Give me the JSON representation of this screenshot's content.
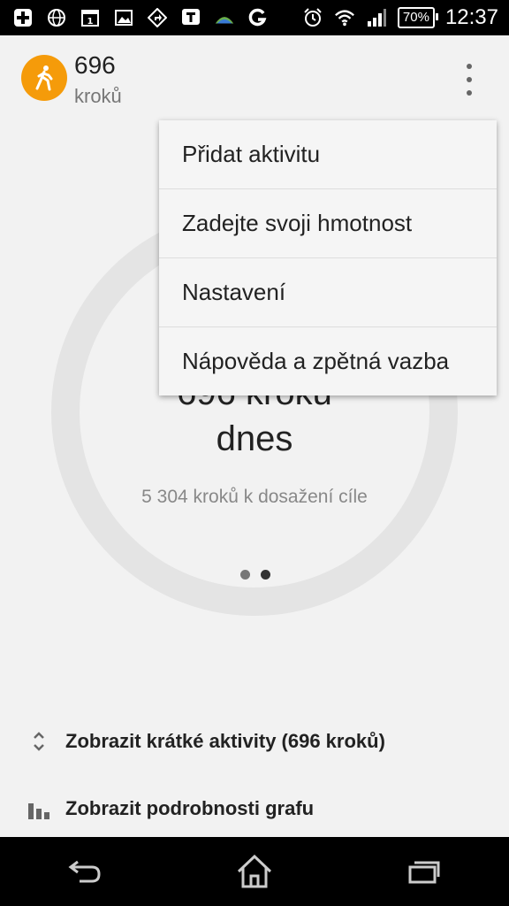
{
  "status_bar": {
    "battery": "70%",
    "time": "12:37",
    "icons": [
      "plus-badge-icon",
      "globe-icon",
      "calendar-icon",
      "image-icon",
      "nav-arrow-icon",
      "t-letter-icon",
      "weather-icon",
      "g-letter-icon",
      "alarm-icon",
      "wifi-icon",
      "signal-icon"
    ]
  },
  "header": {
    "steps": "696",
    "unit": "kroků",
    "avatar_icon": "walking-person-icon"
  },
  "ring": {
    "title_line1": "696 kroků",
    "title_line2": "dnes",
    "subtitle": "5 304 kroků k dosažení cíle",
    "progress_fraction": 0.12
  },
  "menu": {
    "items": [
      {
        "label": "Přidat aktivitu"
      },
      {
        "label": "Zadejte svoji hmotnost"
      },
      {
        "label": "Nastavení"
      },
      {
        "label": "Nápověda a zpětná vazba"
      }
    ]
  },
  "list": {
    "short_activities": "Zobrazit krátké aktivity (696 kroků)",
    "graph_details": "Zobrazit podrobnosti grafu"
  },
  "colors": {
    "accent": "#f59b0a",
    "ring_track": "#e4e4e4",
    "dot_inactive": "#777777",
    "dot_active": "#333333"
  }
}
